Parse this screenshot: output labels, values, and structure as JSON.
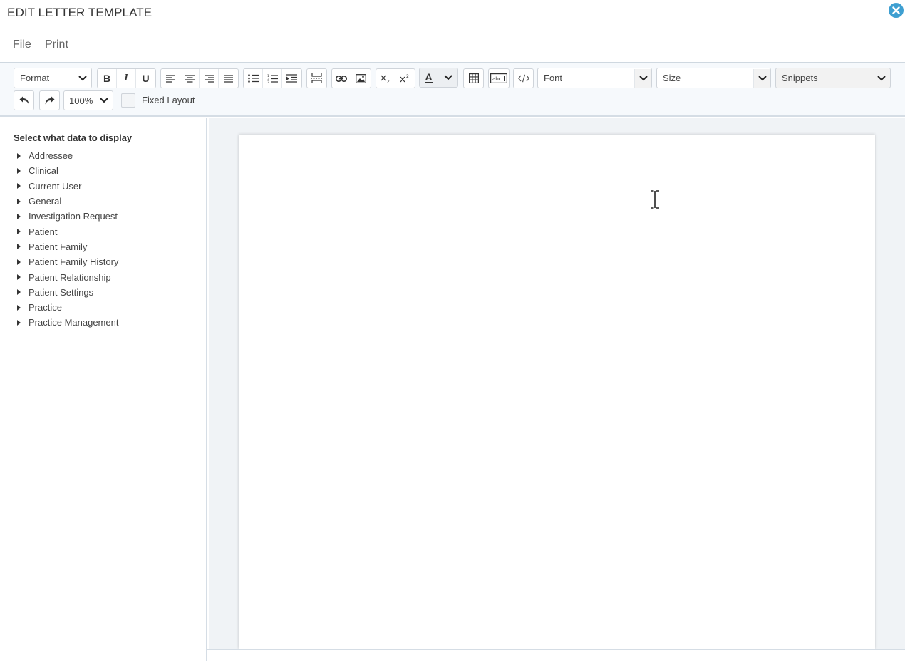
{
  "dialog": {
    "title": "EDIT LETTER TEMPLATE"
  },
  "menu": {
    "file": "File",
    "print": "Print"
  },
  "toolbar": {
    "format": "Format",
    "bold": "B",
    "italic": "I",
    "underline": "U",
    "text_color": "A",
    "font": "Font",
    "size": "Size",
    "snippets": "Snippets",
    "zoom": "100%",
    "fixed_layout": "Fixed Layout"
  },
  "sidebar": {
    "title": "Select what data to display",
    "items": [
      "Addressee",
      "Clinical",
      "Current User",
      "General",
      "Investigation Request",
      "Patient",
      "Patient Family",
      "Patient Family History",
      "Patient Relationship",
      "Patient Settings",
      "Practice",
      "Practice Management"
    ]
  },
  "colors": {
    "accent": "#3e9fd1",
    "toolbar_bg": "#f6f9fc",
    "editor_bg": "#f0f3f6"
  }
}
